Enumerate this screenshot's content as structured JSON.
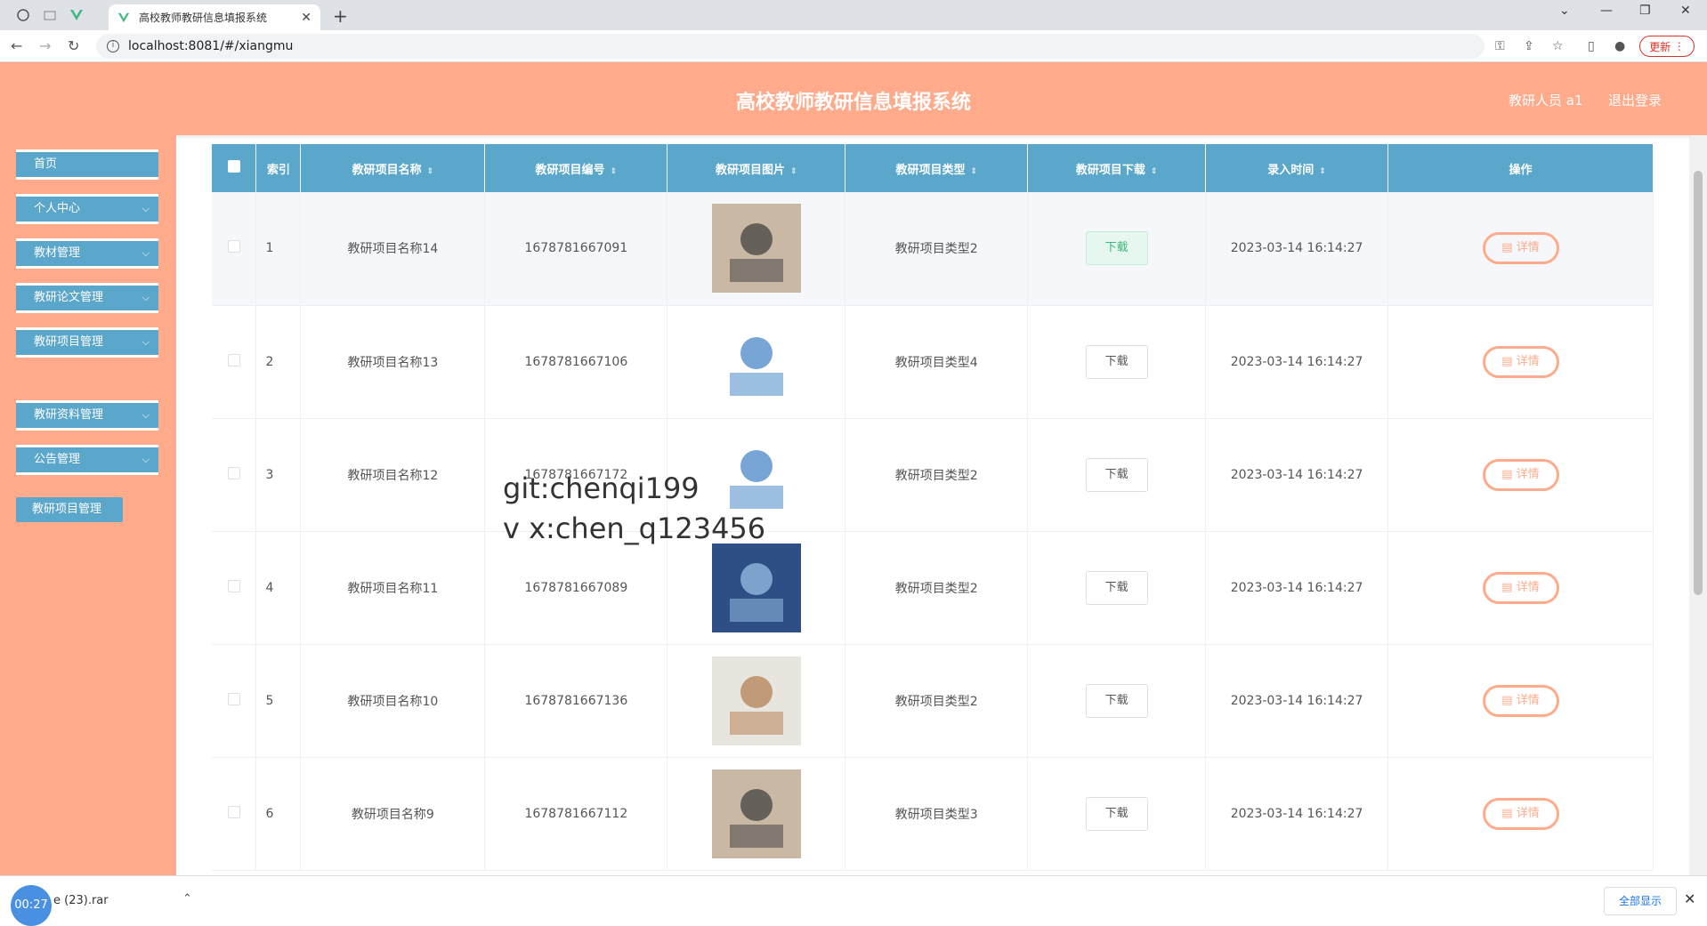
{
  "browser": {
    "tab_title": "高校教师教研信息填报系统",
    "url": "localhost:8081/#/xiangmu",
    "update_label": "更新"
  },
  "header": {
    "title": "高校教师教研信息填报系统",
    "user": "教研人员 a1",
    "logout": "退出登录"
  },
  "sidebar": {
    "items": [
      {
        "label": "首页"
      },
      {
        "label": "个人中心"
      },
      {
        "label": "教材管理"
      },
      {
        "label": "教研论文管理"
      },
      {
        "label": "教研项目管理"
      },
      {
        "label": "教研资料管理"
      },
      {
        "label": "公告管理"
      }
    ],
    "submenu": "教研项目管理"
  },
  "table": {
    "headers": [
      "索引",
      "教研项目名称",
      "教研项目编号",
      "教研项目图片",
      "教研项目类型",
      "教研项目下载",
      "录入时间",
      "操作"
    ],
    "download_label": "下载",
    "detail_label": "详情",
    "rows": [
      {
        "index": "1",
        "name": "教研项目名称14",
        "code": "1678781667091",
        "type": "教研项目类型2",
        "time": "2023-03-14 16:14:27"
      },
      {
        "index": "2",
        "name": "教研项目名称13",
        "code": "1678781667106",
        "type": "教研项目类型4",
        "time": "2023-03-14 16:14:27"
      },
      {
        "index": "3",
        "name": "教研项目名称12",
        "code": "1678781667172",
        "type": "教研项目类型2",
        "time": "2023-03-14 16:14:27"
      },
      {
        "index": "4",
        "name": "教研项目名称11",
        "code": "1678781667089",
        "type": "教研项目类型2",
        "time": "2023-03-14 16:14:27"
      },
      {
        "index": "5",
        "name": "教研项目名称10",
        "code": "1678781667136",
        "type": "教研项目类型2",
        "time": "2023-03-14 16:14:27"
      },
      {
        "index": "6",
        "name": "教研项目名称9",
        "code": "1678781667112",
        "type": "教研项目类型3",
        "time": "2023-03-14 16:14:27"
      }
    ]
  },
  "watermark": {
    "line1": "git:chenqi199",
    "line2": "v x:chen_q123456"
  },
  "downloads": {
    "timer": "00:27",
    "file": "e (23).rar",
    "show_all": "全部显示"
  },
  "colors": {
    "accent": "#ffab8b",
    "menu": "#5ba7cc"
  }
}
